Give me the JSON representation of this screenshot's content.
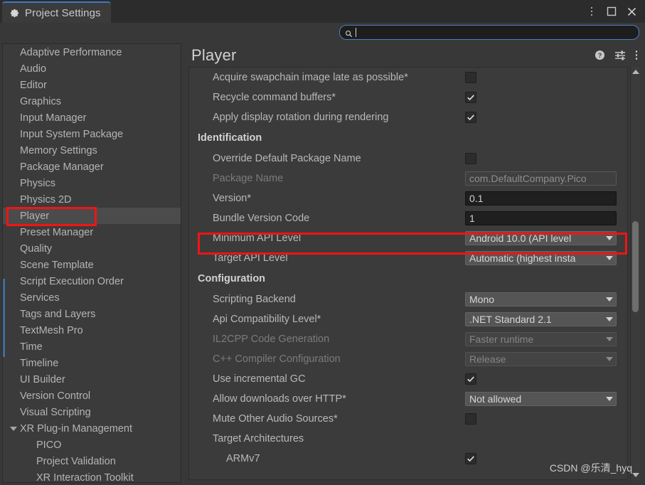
{
  "window": {
    "tab_title": "Project Settings",
    "tab_icon": "gear-icon",
    "controls": [
      {
        "name": "window-menu-button",
        "icon": "kebab-menu-icon"
      },
      {
        "name": "window-maximize-button",
        "icon": "maximize-icon"
      },
      {
        "name": "window-close-button",
        "icon": "close-icon"
      }
    ]
  },
  "search": {
    "icon": "search-icon",
    "value": "",
    "placeholder": ""
  },
  "sidebar": {
    "items": [
      {
        "label": "Adaptive Performance",
        "selected": false,
        "child": false,
        "expandable": false
      },
      {
        "label": "Audio",
        "selected": false,
        "child": false,
        "expandable": false
      },
      {
        "label": "Editor",
        "selected": false,
        "child": false,
        "expandable": false
      },
      {
        "label": "Graphics",
        "selected": false,
        "child": false,
        "expandable": false
      },
      {
        "label": "Input Manager",
        "selected": false,
        "child": false,
        "expandable": false
      },
      {
        "label": "Input System Package",
        "selected": false,
        "child": false,
        "expandable": false
      },
      {
        "label": "Memory Settings",
        "selected": false,
        "child": false,
        "expandable": false
      },
      {
        "label": "Package Manager",
        "selected": false,
        "child": false,
        "expandable": false
      },
      {
        "label": "Physics",
        "selected": false,
        "child": false,
        "expandable": false
      },
      {
        "label": "Physics 2D",
        "selected": false,
        "child": false,
        "expandable": false
      },
      {
        "label": "Player",
        "selected": true,
        "child": false,
        "expandable": false
      },
      {
        "label": "Preset Manager",
        "selected": false,
        "child": false,
        "expandable": false
      },
      {
        "label": "Quality",
        "selected": false,
        "child": false,
        "expandable": false
      },
      {
        "label": "Scene Template",
        "selected": false,
        "child": false,
        "expandable": false
      },
      {
        "label": "Script Execution Order",
        "selected": false,
        "child": false,
        "expandable": false
      },
      {
        "label": "Services",
        "selected": false,
        "child": false,
        "expandable": false
      },
      {
        "label": "Tags and Layers",
        "selected": false,
        "child": false,
        "expandable": false
      },
      {
        "label": "TextMesh Pro",
        "selected": false,
        "child": false,
        "expandable": false
      },
      {
        "label": "Time",
        "selected": false,
        "child": false,
        "expandable": false
      },
      {
        "label": "Timeline",
        "selected": false,
        "child": false,
        "expandable": false
      },
      {
        "label": "UI Builder",
        "selected": false,
        "child": false,
        "expandable": false
      },
      {
        "label": "Version Control",
        "selected": false,
        "child": false,
        "expandable": false
      },
      {
        "label": "Visual Scripting",
        "selected": false,
        "child": false,
        "expandable": false
      },
      {
        "label": "XR Plug-in Management",
        "selected": false,
        "child": false,
        "expandable": true
      },
      {
        "label": "PICO",
        "selected": false,
        "child": true,
        "expandable": false
      },
      {
        "label": "Project Validation",
        "selected": false,
        "child": true,
        "expandable": false
      },
      {
        "label": "XR Interaction Toolkit",
        "selected": false,
        "child": true,
        "expandable": false
      }
    ]
  },
  "panel": {
    "title": "Player",
    "header_icons": [
      {
        "name": "help-icon"
      },
      {
        "name": "preset-icon"
      },
      {
        "name": "panel-menu-icon"
      }
    ],
    "rows": [
      {
        "type": "checkbox",
        "label": "Acquire swapchain image late as possible*",
        "checked": false,
        "indent": 1,
        "disabled": false
      },
      {
        "type": "checkbox",
        "label": "Recycle command buffers*",
        "checked": true,
        "indent": 1,
        "disabled": false
      },
      {
        "type": "checkbox",
        "label": "Apply display rotation during rendering",
        "checked": true,
        "indent": 1,
        "disabled": false
      },
      {
        "type": "section",
        "label": "Identification"
      },
      {
        "type": "checkbox",
        "label": "Override Default Package Name",
        "checked": false,
        "indent": 1,
        "disabled": false
      },
      {
        "type": "text",
        "label": "Package Name",
        "value": "com.DefaultCompany.Pico",
        "indent": 1,
        "disabled": true
      },
      {
        "type": "text",
        "label": "Version*",
        "value": "0.1",
        "indent": 1,
        "disabled": false
      },
      {
        "type": "text",
        "label": "Bundle Version Code",
        "value": "1",
        "indent": 1,
        "disabled": false
      },
      {
        "type": "dropdown",
        "label": "Minimum API Level",
        "value": "Android 10.0 (API level",
        "indent": 1,
        "disabled": false,
        "highlighted": true
      },
      {
        "type": "dropdown",
        "label": "Target API Level",
        "value": "Automatic (highest insta",
        "indent": 1,
        "disabled": false
      },
      {
        "type": "section",
        "label": "Configuration"
      },
      {
        "type": "dropdown",
        "label": "Scripting Backend",
        "value": "Mono",
        "indent": 1,
        "disabled": false
      },
      {
        "type": "dropdown",
        "label": "Api Compatibility Level*",
        "value": ".NET Standard 2.1",
        "indent": 1,
        "disabled": false
      },
      {
        "type": "dropdown",
        "label": "IL2CPP Code Generation",
        "value": "Faster runtime",
        "indent": 1,
        "disabled": true
      },
      {
        "type": "dropdown",
        "label": "C++ Compiler Configuration",
        "value": "Release",
        "indent": 1,
        "disabled": true
      },
      {
        "type": "checkbox",
        "label": "Use incremental GC",
        "checked": true,
        "indent": 1,
        "disabled": false
      },
      {
        "type": "dropdown",
        "label": "Allow downloads over HTTP*",
        "value": "Not allowed",
        "indent": 1,
        "disabled": false
      },
      {
        "type": "checkbox",
        "label": "Mute Other Audio Sources*",
        "checked": false,
        "indent": 1,
        "disabled": false
      },
      {
        "type": "label",
        "label": "Target Architectures",
        "indent": 1
      },
      {
        "type": "checkbox",
        "label": "ARMv7",
        "checked": true,
        "indent": 2,
        "disabled": false
      }
    ]
  },
  "scrollbar": {
    "up_icon": "scroll-up-arrow-icon",
    "down_icon": "scroll-down-arrow-icon"
  },
  "colors": {
    "annotation": "#f21414",
    "accent": "#3b79c6",
    "panel_bg": "#3b3b3b",
    "window_bg": "#383838"
  },
  "watermark": "CSDN @乐清_hyq"
}
